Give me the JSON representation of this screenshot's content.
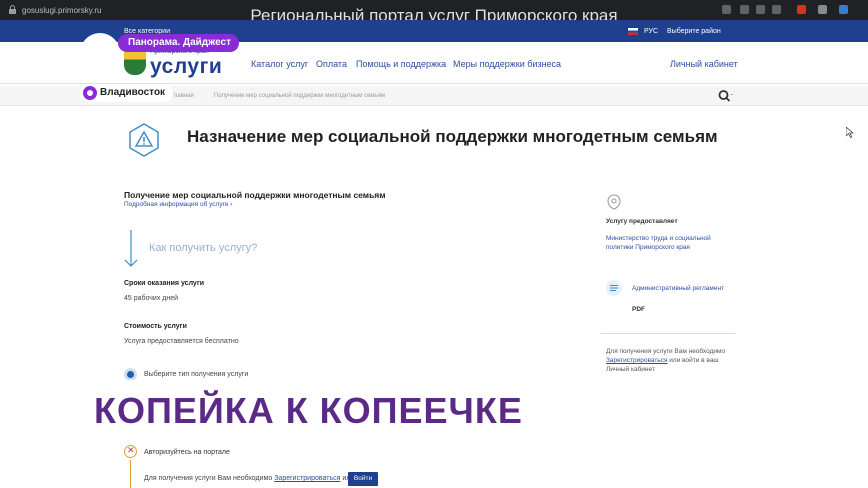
{
  "browser": {
    "url": "gosuslugi.primorsky.ru",
    "tab_title": "Региональный портал услуг Приморского края"
  },
  "topbar": {
    "categories": "Все категории",
    "language": "РУС",
    "region_select": "Выберите район"
  },
  "header": {
    "logo_small": "Приморского края",
    "logo_text": "услуги",
    "nav": [
      "Каталог услуг",
      "Оплата",
      "Помощь и поддержка",
      "Меры поддержки бизнеса"
    ],
    "cabinet": "Личный кабинет"
  },
  "breadcrumb": {
    "home": "Главная",
    "current": "Получение мер социальной поддержки многодетным семьям"
  },
  "page": {
    "title": "Назначение мер социальной поддержки многодетным семьям",
    "service_name": "Получение мер социальной поддержки многодетным семьям",
    "service_more": "Подробная информация об услуге ›",
    "how_to_get": "Как получить услугу?",
    "term_label": "Сроки оказания услуги",
    "term_value": "45 рабочих дней",
    "cost_label": "Стоимость услуги",
    "cost_value": "Услуга предоставляется бесплатно",
    "choose_type": "Выберите тип получения услуги",
    "step_auth": "Авторизуйтесь на портале",
    "step_note_prefix": "Для получения услуги Вам необходимо",
    "step_note_link": "Зарегистрироваться",
    "step_note_suffix": "или",
    "login_button": "Войти"
  },
  "sidebar": {
    "provider_label": "Услугу предоставляет",
    "provider_value": "Министерство труда и социальной политики Приморского края",
    "reglament": "Административный регламент",
    "pdf": "PDF",
    "reg_note_prefix": "Для получения услуги Вам необходимо",
    "reg_note_link": "Зарегистрироваться",
    "reg_note_suffix": "или войти в ваш Личный кабинет"
  },
  "overlay": {
    "panorama": "Панорама. Дайджест",
    "city": "Владивосток",
    "slogan": "КОПЕЙКА К КОПЕЕЧКЕ"
  },
  "colors": {
    "brand_blue": "#1f3f8f",
    "overlay_purple": "#8a2bd8",
    "slogan_purple": "#5b2a86"
  }
}
